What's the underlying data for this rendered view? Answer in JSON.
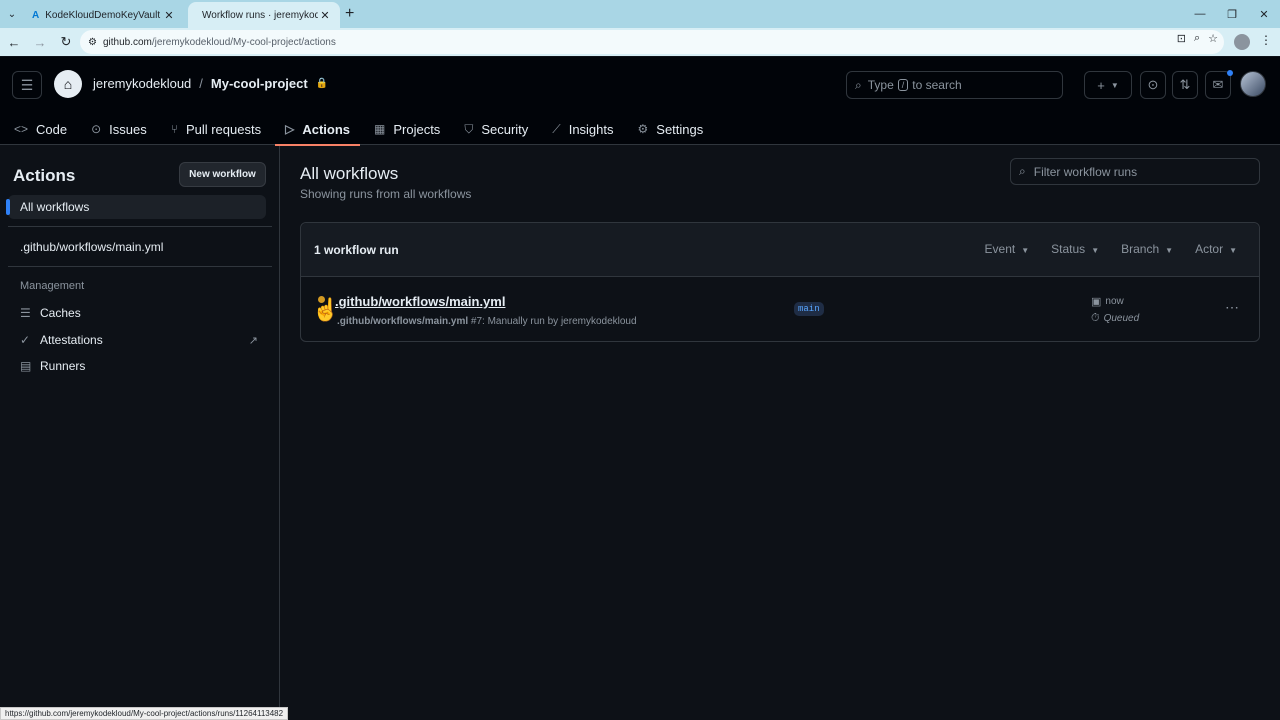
{
  "browser": {
    "tabs": [
      {
        "title": "KodeKloudDemoKeyVault - Mic",
        "active": false
      },
      {
        "title": "Workflow runs · jeremykodeklo",
        "active": true
      }
    ],
    "url_host": "github.com",
    "url_path": "/jeremykodekloud/My-cool-project/actions",
    "status_url": "https://github.com/jeremykodekloud/My-cool-project/actions/runs/11264113482"
  },
  "header": {
    "owner": "jeremykodekloud",
    "separator": "/",
    "repo": "My-cool-project",
    "search_text_before": "Type",
    "search_kbd": "/",
    "search_text_after": "to search"
  },
  "repo_nav": [
    {
      "label": "Code",
      "icon": "code-icon"
    },
    {
      "label": "Issues",
      "icon": "issue-icon"
    },
    {
      "label": "Pull requests",
      "icon": "pull-request-icon"
    },
    {
      "label": "Actions",
      "icon": "play-icon"
    },
    {
      "label": "Projects",
      "icon": "table-icon"
    },
    {
      "label": "Security",
      "icon": "shield-icon"
    },
    {
      "label": "Insights",
      "icon": "graph-icon"
    },
    {
      "label": "Settings",
      "icon": "gear-icon"
    }
  ],
  "sidebar": {
    "title": "Actions",
    "new_workflow": "New workflow",
    "all_workflows": "All workflows",
    "workflow_file": ".github/workflows/main.yml",
    "management_label": "Management",
    "management_items": [
      {
        "label": "Caches",
        "icon": "database-icon"
      },
      {
        "label": "Attestations",
        "icon": "check-circle-icon"
      },
      {
        "label": "Runners",
        "icon": "server-icon"
      }
    ]
  },
  "main": {
    "title": "All workflows",
    "subtitle": "Showing runs from all workflows",
    "filter_placeholder": "Filter workflow runs",
    "run_count": "1 workflow run",
    "filters": [
      "Event",
      "Status",
      "Branch",
      "Actor"
    ],
    "run": {
      "title": ".github/workflows/main.yml",
      "meta_file": ".github/workflows/main.yml",
      "meta_rest": "#7: Manually run by jeremykodekloud",
      "branch": "main",
      "time": "now",
      "status": "Queued",
      "status_color": "#d29922"
    }
  }
}
